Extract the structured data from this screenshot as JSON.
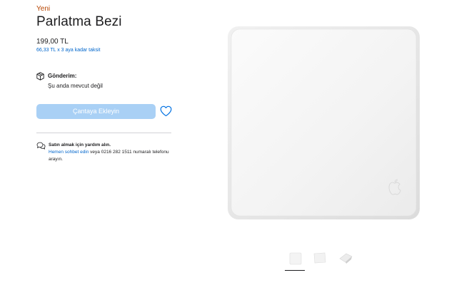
{
  "product": {
    "badge": "Yeni",
    "title": "Parlatma Bezi",
    "price": "199,00 TL",
    "installment": "66,33 TL x 3 aya kadar taksit"
  },
  "delivery": {
    "title": "Gönderim:",
    "status": "Şu anda mevcut değil",
    "icon": "box-icon"
  },
  "actions": {
    "add_to_bag": "Çantaya Ekleyin",
    "favorite_icon": "heart-icon"
  },
  "help": {
    "title": "Satın almak için yardım alın.",
    "link_text": "Hemen sohbet edin",
    "body_text": " veya 0216 282 1511 numaralı telefonu arayın.",
    "icon": "chat-bubbles-icon"
  },
  "gallery": {
    "thumbnails": [
      {
        "name": "cloth-front-thumbnail",
        "selected": true
      },
      {
        "name": "cloth-angle-thumbnail",
        "selected": false
      },
      {
        "name": "cloth-folded-thumbnail",
        "selected": false
      }
    ]
  },
  "colors": {
    "new_badge": "#b64400",
    "link": "#0066cc",
    "button_disabled": "#a9d0f5",
    "text": "#1d1d1f"
  }
}
